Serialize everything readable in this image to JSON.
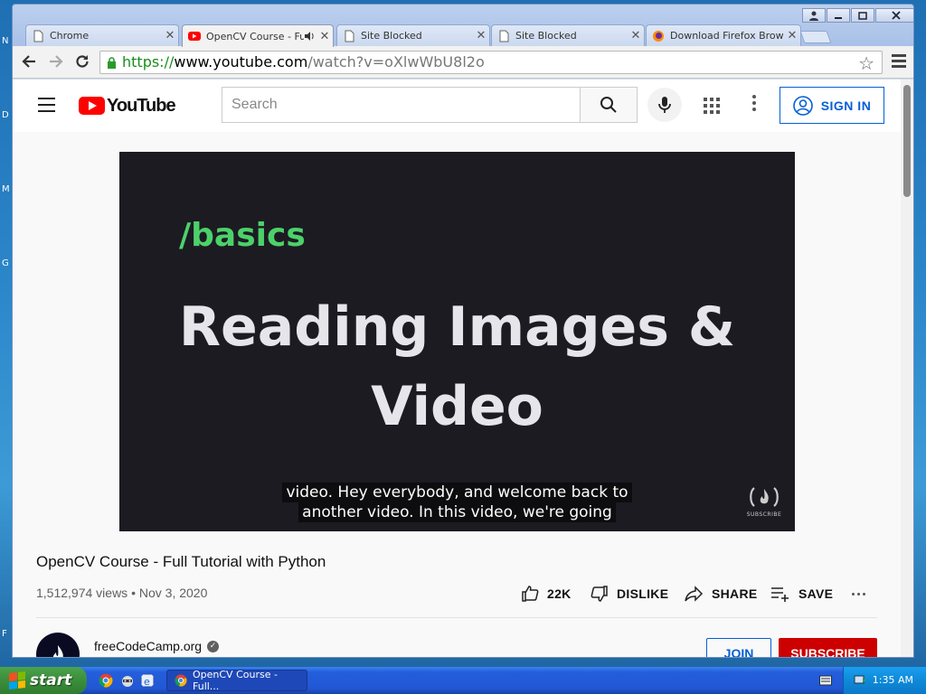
{
  "browser": {
    "tabs": [
      {
        "title": "Chrome",
        "favicon": "document-icon",
        "active": false
      },
      {
        "title": "OpenCV Course - Ful",
        "favicon": "youtube-icon",
        "active": true,
        "audio": true
      },
      {
        "title": "Site Blocked",
        "favicon": "document-icon",
        "active": false
      },
      {
        "title": "Site Blocked",
        "favicon": "document-icon",
        "active": false
      },
      {
        "title": "Download Firefox Brows",
        "favicon": "firefox-icon",
        "active": false
      }
    ],
    "window_controls": [
      "user-icon",
      "minimize-icon",
      "restore-icon",
      "close-icon"
    ],
    "address": {
      "scheme": "https://",
      "host": "www.youtube.com",
      "path": "/watch?v=oXlwWbU8l2o"
    }
  },
  "youtube": {
    "logo_text": "YouTube",
    "search_placeholder": "Search",
    "sign_in_label": "SIGN IN",
    "video": {
      "overlay_tag": "/basics",
      "headline_line1": "Reading Images &",
      "headline_line2": "Video",
      "caption_line1": "video. Hey everybody, and welcome back to",
      "caption_line2": "another video. In this video, we're going",
      "watermark_text": "SUBSCRIBE",
      "title": "OpenCV Course - Full Tutorial with Python",
      "views": "1,512,974 views",
      "separator": "•",
      "date": "Nov 3, 2020"
    },
    "actions": {
      "like_count": "22K",
      "dislike": "DISLIKE",
      "share": "SHARE",
      "save": "SAVE"
    },
    "channel": {
      "name": "freeCodeCamp.org",
      "join": "JOIN",
      "subscribe": "SUBSCRIBE"
    }
  },
  "taskbar": {
    "start_label": "start",
    "task_button": "OpenCV Course - Full...",
    "clock": "1:35 AM"
  },
  "desktop": {
    "edge_letters": [
      "N",
      "D",
      "M",
      "G",
      "F"
    ]
  },
  "colors": {
    "youtube_red": "#ff0000",
    "link_blue": "#065fd4",
    "subscribe_red": "#cc0000",
    "basics_green": "#4cd16a"
  }
}
